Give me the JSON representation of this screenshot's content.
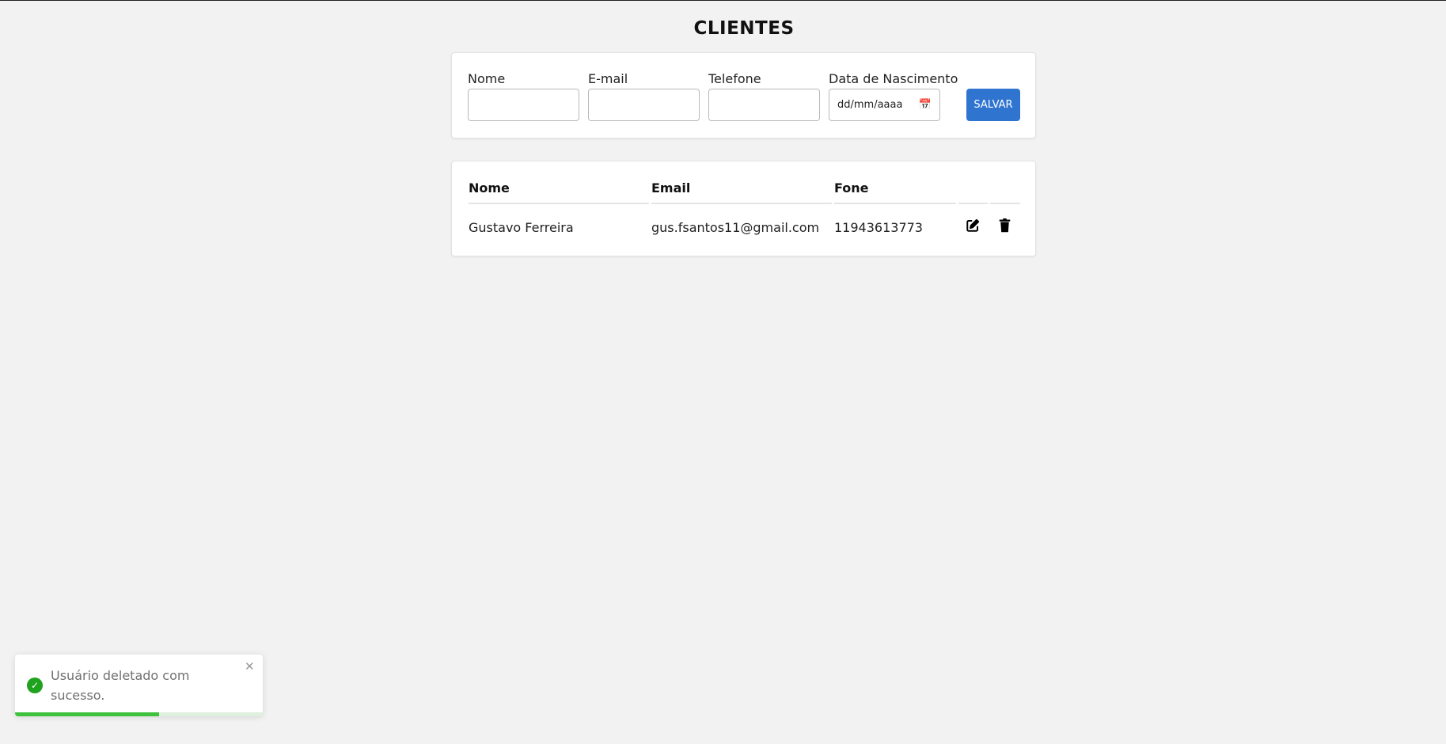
{
  "page": {
    "title": "CLIENTES"
  },
  "form": {
    "fields": [
      {
        "label": "Nome",
        "value": ""
      },
      {
        "label": "E-mail",
        "value": ""
      },
      {
        "label": "Telefone",
        "value": ""
      },
      {
        "label": "Data de Nascimento",
        "placeholder": "dd/mm/aaaa"
      }
    ],
    "save_label": "SALVAR"
  },
  "table": {
    "headers": [
      "Nome",
      "Email",
      "Fone"
    ],
    "rows": [
      {
        "nome": "Gustavo Ferreira",
        "email": "gus.fsantos11@gmail.com",
        "fone": "11943613773"
      }
    ]
  },
  "icons": {
    "edit": "edit-icon",
    "delete": "trash-icon",
    "calendar": "calendar-icon",
    "success": "check-circle-icon",
    "close": "close-icon"
  },
  "toast": {
    "message": "Usuário deletado com sucesso.",
    "progress": 0.58,
    "close_symbol": "✕"
  },
  "colors": {
    "primary": "#2f75d0",
    "success": "#1fa31f",
    "background": "#f2f2f2"
  }
}
